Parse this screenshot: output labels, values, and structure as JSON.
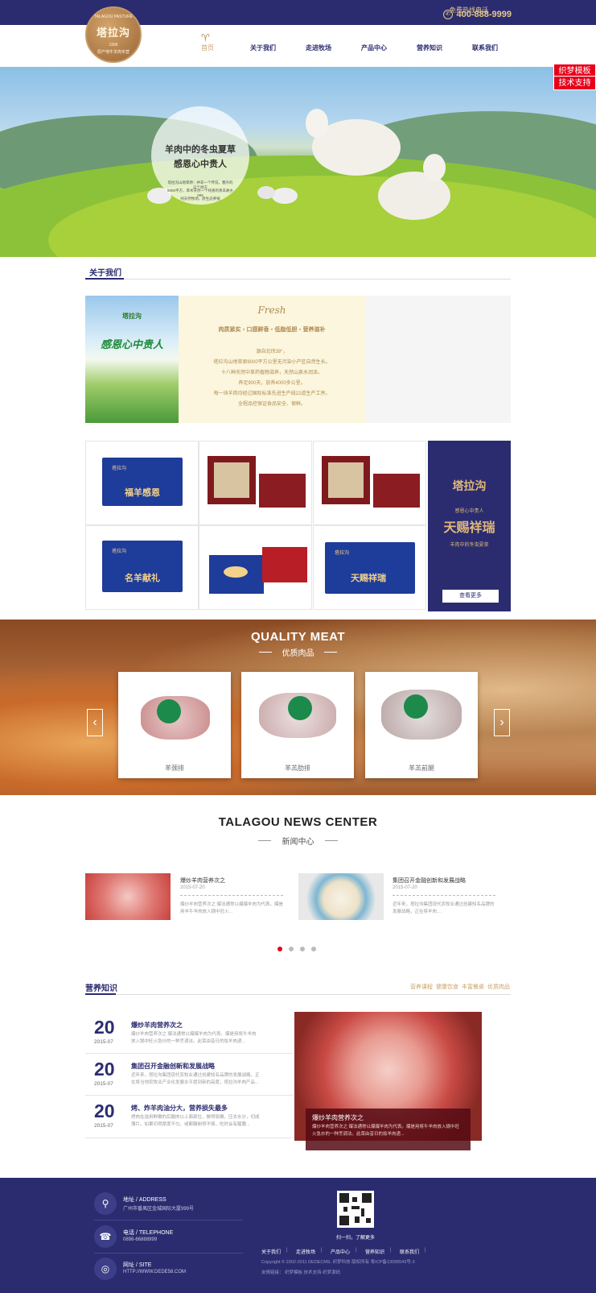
{
  "topbar": {
    "hotline_label": "免费热线电话",
    "hotline_number": "400-888-9999"
  },
  "logo": {
    "top_text": "TALAGOU PASTURE",
    "main_text": "塔拉沟",
    "year": "1996",
    "sub_text": "原产地牛羊肉专营"
  },
  "nav": {
    "items": [
      "首页",
      "关于我们",
      "走进牧场",
      "产品中心",
      "营养知识",
      "联系我们"
    ]
  },
  "side_tabs": [
    "织梦模板",
    "技术支持"
  ],
  "banner": {
    "title1": "羊肉中的冬虫夏草",
    "title2": "感恩心中贵人",
    "small_lines": [
      "塔拉沟山地草原：并非一个传说，塞外的这个地方",
      "8000平方，草木天然一个纯香的青羊故乡999",
      "纯天然牧场，原生态养殖"
    ]
  },
  "about": {
    "title": "关于我们",
    "fresh": "Fresh",
    "tagline": "肉质紧实・口感鲜香・低脂低胆・营养滋补",
    "lines": [
      "源自北纬39°，",
      "塔拉沟山地草原8000平方公里无污染小产区自然生长。",
      "十八种天然中草药植物滋养，天然山泉水润泽。",
      "养足900天，放养4000多公里。",
      "每一块羊肉均经过国际标准先进生产线22道生产工序。",
      "全程品控保证食品安全、保鲜。"
    ],
    "image_text": "感恩心中贵人",
    "image_brand": "塔拉沟"
  },
  "products": {
    "boxes": [
      "福羊感恩",
      "",
      "",
      "名羊献礼",
      "",
      "天赐祥瑞"
    ],
    "brand": "塔拉沟",
    "promo_brand": "塔拉沟",
    "promo_sub": "感恩心中贵人",
    "promo_title": "天赐祥瑞",
    "promo_tag": "羊肉中的冬虫夏草",
    "more_button": "查看更多"
  },
  "quality": {
    "title": "QUALITY MEAT",
    "subtitle": "优质肉品",
    "items": [
      "羊颈排",
      "羊羔肋排",
      "羊羔前腿"
    ]
  },
  "news": {
    "title": "TALAGOU NEWS CENTER",
    "subtitle": "新闻中心",
    "items": [
      {
        "title": "爆炒羊肉营养次之",
        "date": "2015-07-20",
        "summary": "爆炒羊肉营养次之 爆法通常以爆爆羊肉为代表。爆是用羊牛羊肉放入锅中旺火..."
      },
      {
        "title": "集团召开金融创新和发展战略",
        "date": "2015-07-20",
        "summary": "近年来，塔拉沟集团现代农牧业通过创建知名品牌的发展战略，正在将羊肉...."
      }
    ]
  },
  "nutrition": {
    "title": "营养知识",
    "tags": [
      "营养课程",
      "健康饮食",
      "丰富餐桌",
      "优质肉品"
    ],
    "items": [
      {
        "day": "20",
        "month": "2015-07",
        "title": "爆炒羊肉营养次之",
        "summary": "爆炒羊肉营养次之 爆法通常以爆爆羊肉为代表。爆是用将牛羊肉放入锅中旺火急炒的一种烹调法。此菜由昔日的烩羊肉递..."
      },
      {
        "day": "20",
        "month": "2015-07",
        "title": "集团召开金融创新和发展战略",
        "summary": "近年来，塔拉沟集团现代农牧业通过创建知名品牌的发展战略，正在将当地农牧业产业化发展水平提到新的高度，塔拉沟羊肉产品..."
      },
      {
        "day": "20",
        "month": "2015-07",
        "title": "烤、炸羊肉油分大，营养损失最多",
        "summary": "烤肉在选用鲜嫩的后腿肉以上面部位，做得软嫩，压去水分，切成薄片。如果切得厚度不匀，或都腌制得不够，吃时会有腥膻..."
      }
    ],
    "feature_title": "爆炒羊肉营养次之",
    "feature_summary": "爆炒羊肉营养次之 爆法通常以爆爆羊肉为代表。爆是用将牛羊肉放入锅中旺火急炒的一种烹调法。此菜由昔日的烩羊肉递..."
  },
  "footer": {
    "address_label": "地址 / ADDRESS",
    "address": "广州市番禺区金城国际大厦999号",
    "phone_label": "电话 / TELEPHONE",
    "phone": "0898-66888999",
    "site_label": "网址 / SITE",
    "site": "HTTP://WWW.DEDE58.COM",
    "qr_text": "扫一扫，了解更多",
    "links": [
      "关于我们",
      "走进牧场",
      "产品中心",
      "营养知识",
      "联系我们"
    ],
    "copyright": "Copyright © 2002-2011 DEDECMS. 织梦科技 版权所有   粤ICP备13036543号-3",
    "sub_links": "友情链接：   织梦模板     技术支持     织梦源码"
  },
  "colors": {
    "navy": "#2b2c70",
    "gold": "#c9a26a",
    "red_tab": "#e8001a"
  }
}
